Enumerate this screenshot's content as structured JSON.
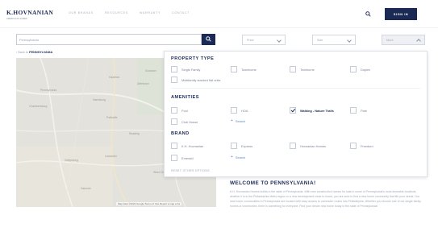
{
  "header": {
    "logo_main": "K.HOVNANIAN",
    "logo_sub": "AMERICAN HOMES",
    "nav": [
      "OUR BRANDS",
      "RESOURCES",
      "WARRANTY",
      "CONTACT"
    ],
    "signin_label": "SIGN IN",
    "search_icon": "search-icon"
  },
  "search": {
    "value": "Pennsylvania",
    "button_icon": "search-icon",
    "filters": [
      "Price",
      "Size",
      "More"
    ],
    "active_filter": "More"
  },
  "breadcrumb": {
    "prefix": "‹ Back to",
    "current": "PENNSYLVANIA"
  },
  "map": {
    "labels": [
      "Pennsylvania",
      "Lancaster",
      "Gettysburg",
      "Harrisburg",
      "Allentown",
      "Reading",
      "Scranton",
      "Hazleton",
      "Pottsville",
      "Chambersburg",
      "Hanover",
      "West Chester"
    ],
    "attribution": "Map data ©2023 Google   Terms of Use   Report a map error"
  },
  "filters_panel": {
    "property_type": {
      "title": "PROPERTY TYPE",
      "options": [
        "Single Family",
        "Townhome",
        "Twinhome",
        "Duplex",
        "Multifamily stacked flat units"
      ]
    },
    "amenities": {
      "title": "AMENITIES",
      "options": [
        "Pool",
        "HOA",
        "Walking - Nature Trails",
        "Park",
        "Club House"
      ],
      "checked": "Walking - Nature Trails",
      "more_label": "Search"
    },
    "brand": {
      "title": "BRAND",
      "options": [
        "K.H. Hovnanian",
        "Express",
        "Hovnanian Homes",
        "Freedom",
        "Emerald"
      ],
      "more_label": "Search"
    },
    "reset_label": "RESET OTHER OPTIONS"
  },
  "welcome": {
    "title": "WELCOME TO PENNSYLVANIA!",
    "body": "K.H. Hovnanian Homes builds in the state of Pennsylvania. With new construction homes for sale in some of Pennsylvania's most desirable locations, whether it is in the Philadelphia Metro region or a new development close to home, you are sure to find a new home community that fits your needs. Our new home communities in Pennsylvania are located with easy access to commuter routes into Philadelphia. Whether you choose one of our single family homes or townhomes, there is something for everyone. Find your dream new home today in the state of Pennsylvania!"
  },
  "colors": {
    "navy": "#1b2a55",
    "link": "#5d86c8",
    "map": "#e4e2dc"
  }
}
